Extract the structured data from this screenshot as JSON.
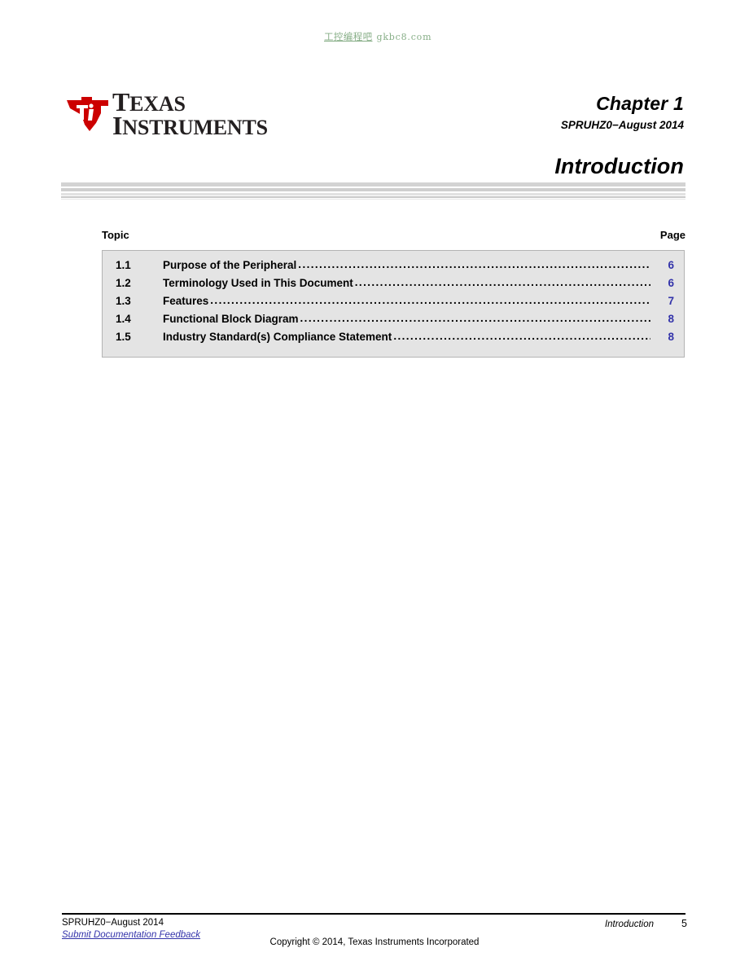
{
  "watermark": {
    "chinese": "工控编程吧",
    "latin": "gkbc8.com",
    "color": "#7da87d"
  },
  "header": {
    "logo": {
      "icon": "ti-texas-logo-icon",
      "line1_cap": "T",
      "line1_rest": "EXAS",
      "line2_cap": "I",
      "line2_rest": "NSTRUMENTS",
      "brand_red": "#cc0000",
      "brand_black": "#231f20"
    },
    "chapter_label": "Chapter 1",
    "document_id": "SPRUHZ0−August 2014"
  },
  "title": {
    "text": "Introduction"
  },
  "toc": {
    "col_topic": "Topic",
    "col_page": "Page",
    "leader_dots": "..................................................................................................................................................",
    "page_color": "#3333aa",
    "rows": [
      {
        "number": "1.1",
        "label": "Purpose of the Peripheral",
        "page": "6"
      },
      {
        "number": "1.2",
        "label": "Terminology Used in This Document",
        "page": "6"
      },
      {
        "number": "1.3",
        "label": "Features",
        "page": "7"
      },
      {
        "number": "1.4",
        "label": "Functional Block Diagram",
        "page": "8"
      },
      {
        "number": "1.5",
        "label": "Industry Standard(s) Compliance Statement",
        "page": "8"
      }
    ]
  },
  "footer": {
    "document_id": "SPRUHZ0−August 2014",
    "feedback_link": "Submit Documentation Feedback",
    "chapter_name": "Introduction",
    "page_number": "5",
    "copyright": "Copyright © 2014, Texas Instruments Incorporated"
  }
}
